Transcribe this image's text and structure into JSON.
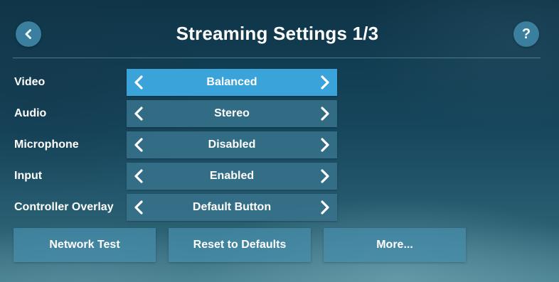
{
  "header": {
    "title": "Streaming Settings 1/3",
    "back_icon": "chevron-left-icon",
    "help_label": "?"
  },
  "settings": [
    {
      "label": "Video",
      "value": "Balanced",
      "selected": true
    },
    {
      "label": "Audio",
      "value": "Stereo",
      "selected": false
    },
    {
      "label": "Microphone",
      "value": "Disabled",
      "selected": false
    },
    {
      "label": "Input",
      "value": "Enabled",
      "selected": false
    },
    {
      "label": "Controller Overlay",
      "value": "Default Button",
      "selected": false
    }
  ],
  "actions": {
    "network_test": "Network Test",
    "reset_defaults": "Reset to Defaults",
    "more": "More..."
  },
  "colors": {
    "selected_row": "#3aa3da",
    "row": "#37738c",
    "button": "#468caa",
    "round_button": "#3b7f9e"
  }
}
